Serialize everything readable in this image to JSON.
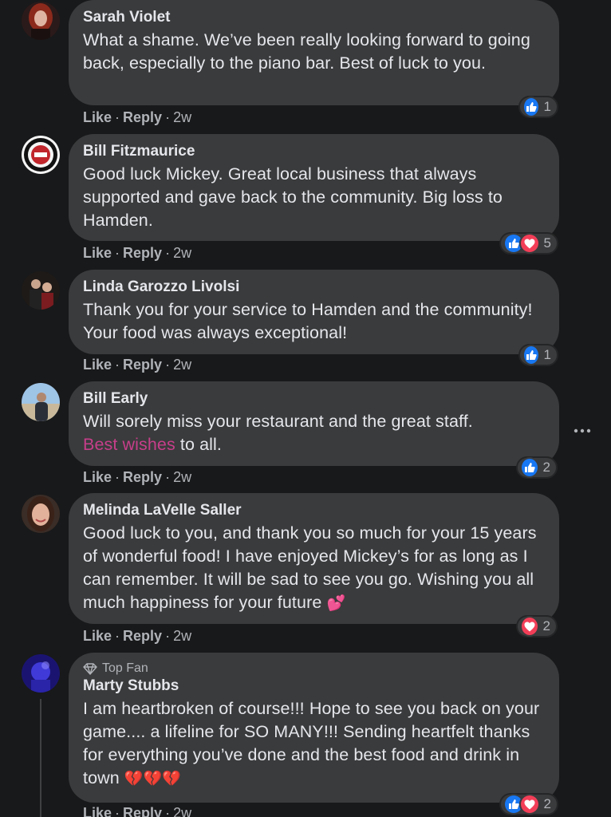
{
  "comments": [
    {
      "author": "Sarah Violet",
      "text": "What a shame. We’ve been really looking forward to going back, especially to the piano bar. Best of luck to you.",
      "like_label": "Like",
      "reply_label": "Reply",
      "time": "2w",
      "reactions": [
        "like"
      ],
      "reaction_count": "1"
    },
    {
      "author": "Bill Fitzmaurice",
      "text": "Good luck Mickey. Great local business that always supported and gave back to the community. Big loss to Hamden.",
      "like_label": "Like",
      "reply_label": "Reply",
      "time": "2w",
      "reactions": [
        "like",
        "love"
      ],
      "reaction_count": "5"
    },
    {
      "author": "Linda Garozzo Livolsi",
      "text": "Thank you for your service to Hamden and the community! Your food was always exceptional!",
      "like_label": "Like",
      "reply_label": "Reply",
      "time": "2w",
      "reactions": [
        "like"
      ],
      "reaction_count": "1"
    },
    {
      "author": "Bill Early",
      "text_pre": "Will sorely miss your restaurant and the great staff.",
      "text_highlight": "Best wishes",
      "text_post": " to all.",
      "like_label": "Like",
      "reply_label": "Reply",
      "time": "2w",
      "reactions": [
        "like"
      ],
      "reaction_count": "2"
    },
    {
      "author": "Melinda LaVelle Saller",
      "text": "Good luck to you, and thank you so much for your 15 years of wonderful food! I have enjoyed Mickey’s for as long as I can remember. It will be sad to see you go. Wishing you all much happiness for your future",
      "emoji": "💕",
      "like_label": "Like",
      "reply_label": "Reply",
      "time": "2w",
      "reactions": [
        "love"
      ],
      "reaction_count": "2"
    },
    {
      "badge": "Top Fan",
      "author": "Marty Stubbs",
      "text": "I am heartbroken of course!!! Hope to see you back on your game.... a lifeline for SO MANY!!! Sending heartfelt thanks for everything you’ve done and the best food and drink in town",
      "emoji": "💔💔💔",
      "like_label": "Like",
      "reply_label": "Reply",
      "time": "2w",
      "reactions": [
        "like",
        "love"
      ],
      "reaction_count": "2"
    }
  ],
  "colors": {
    "background": "#18191a",
    "bubble": "#3a3b3c",
    "text": "#e4e6eb",
    "secondary_text": "#b0b3b8",
    "like_blue": "#1877f2",
    "love_red": "#f33e58",
    "highlight_pink": "#c63e8a"
  },
  "icons": [
    "like-reaction-icon",
    "love-reaction-icon",
    "more-options-icon",
    "top-fan-diamond-icon"
  ]
}
